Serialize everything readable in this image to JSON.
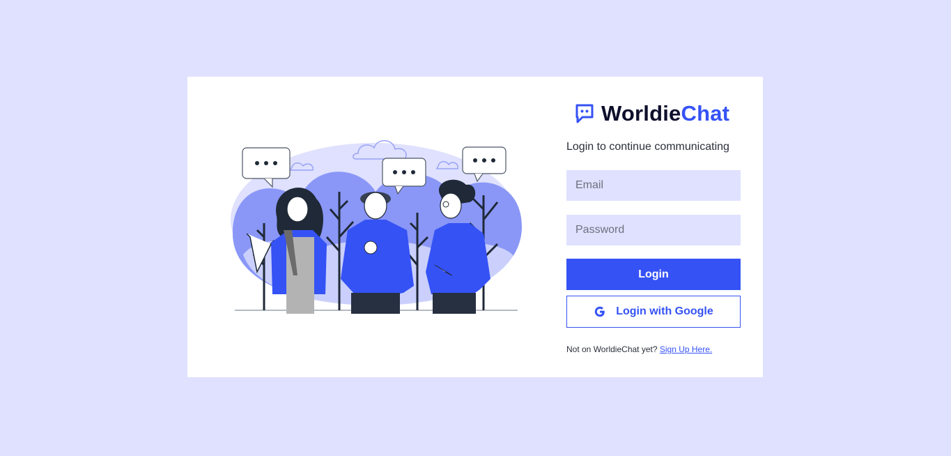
{
  "brand": {
    "part1": "Worldie",
    "part2": "Chat",
    "accent": "#3552f5",
    "dark": "#0d0f2b"
  },
  "subtitle": "Login to continue communicating",
  "form": {
    "email_placeholder": "Email",
    "password_placeholder": "Password",
    "login_label": "Login",
    "google_label": "Login with Google"
  },
  "signup": {
    "prompt": "Not on WorldieChat yet?",
    "link": "Sign Up Here."
  },
  "colors": {
    "background": "#dfe1fe",
    "card": "#ffffff",
    "field": "#dfe1fe",
    "primary": "#3552f5"
  },
  "icons": {
    "brand": "chat-bubble-icon",
    "google": "google-g-icon"
  }
}
